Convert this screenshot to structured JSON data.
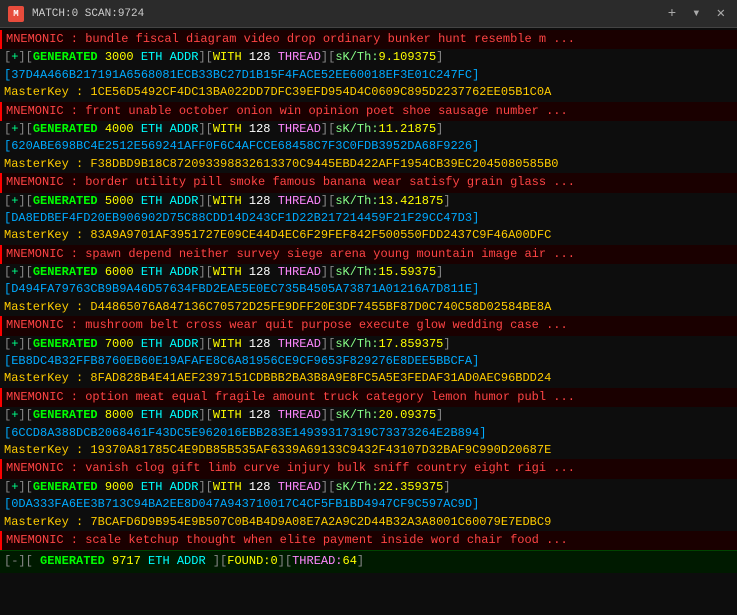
{
  "titleBar": {
    "icon": "M",
    "text": "MATCH:0 SCAN:9724",
    "closeLabel": "✕",
    "plusLabel": "+",
    "chevronLabel": "▾"
  },
  "rows": [
    {
      "type": "mnemonic",
      "text": "MNEMONIC : bundle fiscal diagram video drop ordinary bunker hunt resemble m ..."
    },
    {
      "type": "generated",
      "number": "3000",
      "coin": "ETH ADDR",
      "bits": "128",
      "skth": "9.109375"
    },
    {
      "type": "hash",
      "text": "37D4A466B217191A6568081ECB33BC27D1B15F4FACE52EE60018EF3E01C247FC"
    },
    {
      "type": "masterkey",
      "text": "1CE56D5492CF4DC13BA022DD7DFC39EFD954D4C0609C895D2237762EE05B1C0A"
    },
    {
      "type": "mnemonic",
      "text": "MNEMONIC : front unable october onion win opinion poet shoe sausage number ..."
    },
    {
      "type": "generated",
      "number": "4000",
      "coin": "ETH ADDR",
      "bits": "128",
      "skth": "11.21875"
    },
    {
      "type": "hash",
      "text": "620ABE698BC4E2512E569241AFF0F6C4AFCCE68458C7F3C0FDB3952DA68F9226"
    },
    {
      "type": "masterkey",
      "text": "F38DBD9B18C872093398832613370C9445EBD422AFF1954CB39EC2045080585B0"
    },
    {
      "type": "mnemonic",
      "text": "MNEMONIC : border utility pill smoke famous banana wear satisfy grain glass ..."
    },
    {
      "type": "generated",
      "number": "5000",
      "coin": "ETH ADDR",
      "bits": "128",
      "skth": "13.421875"
    },
    {
      "type": "hash",
      "text": "DA8EDBEF4FD20EB906902D75C88CDD14D243CF1D22B217214459F21F29CC47D3"
    },
    {
      "type": "masterkey",
      "text": "83A9A9701AF3951727E09CE44D4EC6F29FEF842F500550FDD2437C9F46A00DFC"
    },
    {
      "type": "mnemonic",
      "text": "MNEMONIC : spawn depend neither survey siege arena young mountain image air ..."
    },
    {
      "type": "generated",
      "number": "6000",
      "coin": "ETH ADDR",
      "bits": "128",
      "skth": "15.59375"
    },
    {
      "type": "hash",
      "text": "D494FA79763CB9B9A46D57634FBD2EAE5E0EC735B4505A73871A01216A7D811E"
    },
    {
      "type": "masterkey",
      "text": "D44865076A847136C70572D25FE9DFF20E3DF7455BF87D0C740C58D02584BE8A"
    },
    {
      "type": "mnemonic",
      "text": "MNEMONIC : mushroom belt cross wear quit purpose execute glow wedding case ..."
    },
    {
      "type": "generated",
      "number": "7000",
      "coin": "ETH ADDR",
      "bits": "128",
      "skth": "17.859375"
    },
    {
      "type": "hash",
      "text": "EB8DC4B32FFB8760EB60E19AFAFE8C6A81956CE9CF9653F829276E8DEE5BBCFA"
    },
    {
      "type": "masterkey",
      "text": "8FAD828B4E41AEF2397151CDBBB2BA3B8A9E8FC5A5E3FEDAF31AD0AEC96BDD24"
    },
    {
      "type": "mnemonic",
      "text": "MNEMONIC : option meat equal fragile amount truck category lemon humor publ ..."
    },
    {
      "type": "generated",
      "number": "8000",
      "coin": "ETH ADDR",
      "bits": "128",
      "skth": "20.09375"
    },
    {
      "type": "hash",
      "text": "6CCD8A388DCB2068461F43DC5E962016EBB283E14939317319C73373264E2B894"
    },
    {
      "type": "masterkey",
      "text": "19370A81785C4E9DB85B535AF6339A69133C9432F43107D32BAF9C990D20687E"
    },
    {
      "type": "mnemonic",
      "text": "MNEMONIC : vanish clog gift limb curve injury bulk sniff country eight rigi ..."
    },
    {
      "type": "generated",
      "number": "9000",
      "coin": "ETH ADDR",
      "bits": "128",
      "skth": "22.359375"
    },
    {
      "type": "hash",
      "text": "0DA333FA6EE3B713C94BA2EE8D047A943710017C4CF5FB1BD4947CF9C597AC9D"
    },
    {
      "type": "masterkey",
      "text": "7BCAFD6D9B954E9B507C0B4B4D9A08E7A2A9C2D44B32A3A8001C60079E7EDBC9"
    },
    {
      "type": "mnemonic",
      "text": "MNEMONIC : scale ketchup thought when elite payment inside word chair food ..."
    },
    {
      "type": "status",
      "scanNum": "9717",
      "coin": "ETH ADDR",
      "found": "0",
      "thread": "64"
    }
  ],
  "labels": {
    "mnemonic": "MNEMONIC",
    "generated": "GENERATED",
    "eth_addr": "ETH ADDR",
    "with": "WITH",
    "thread": "THREAD",
    "skth": "sK/Th:",
    "masterkey": "MasterKey :",
    "found": "FOUND:",
    "threadLabel": "THREAD:"
  }
}
